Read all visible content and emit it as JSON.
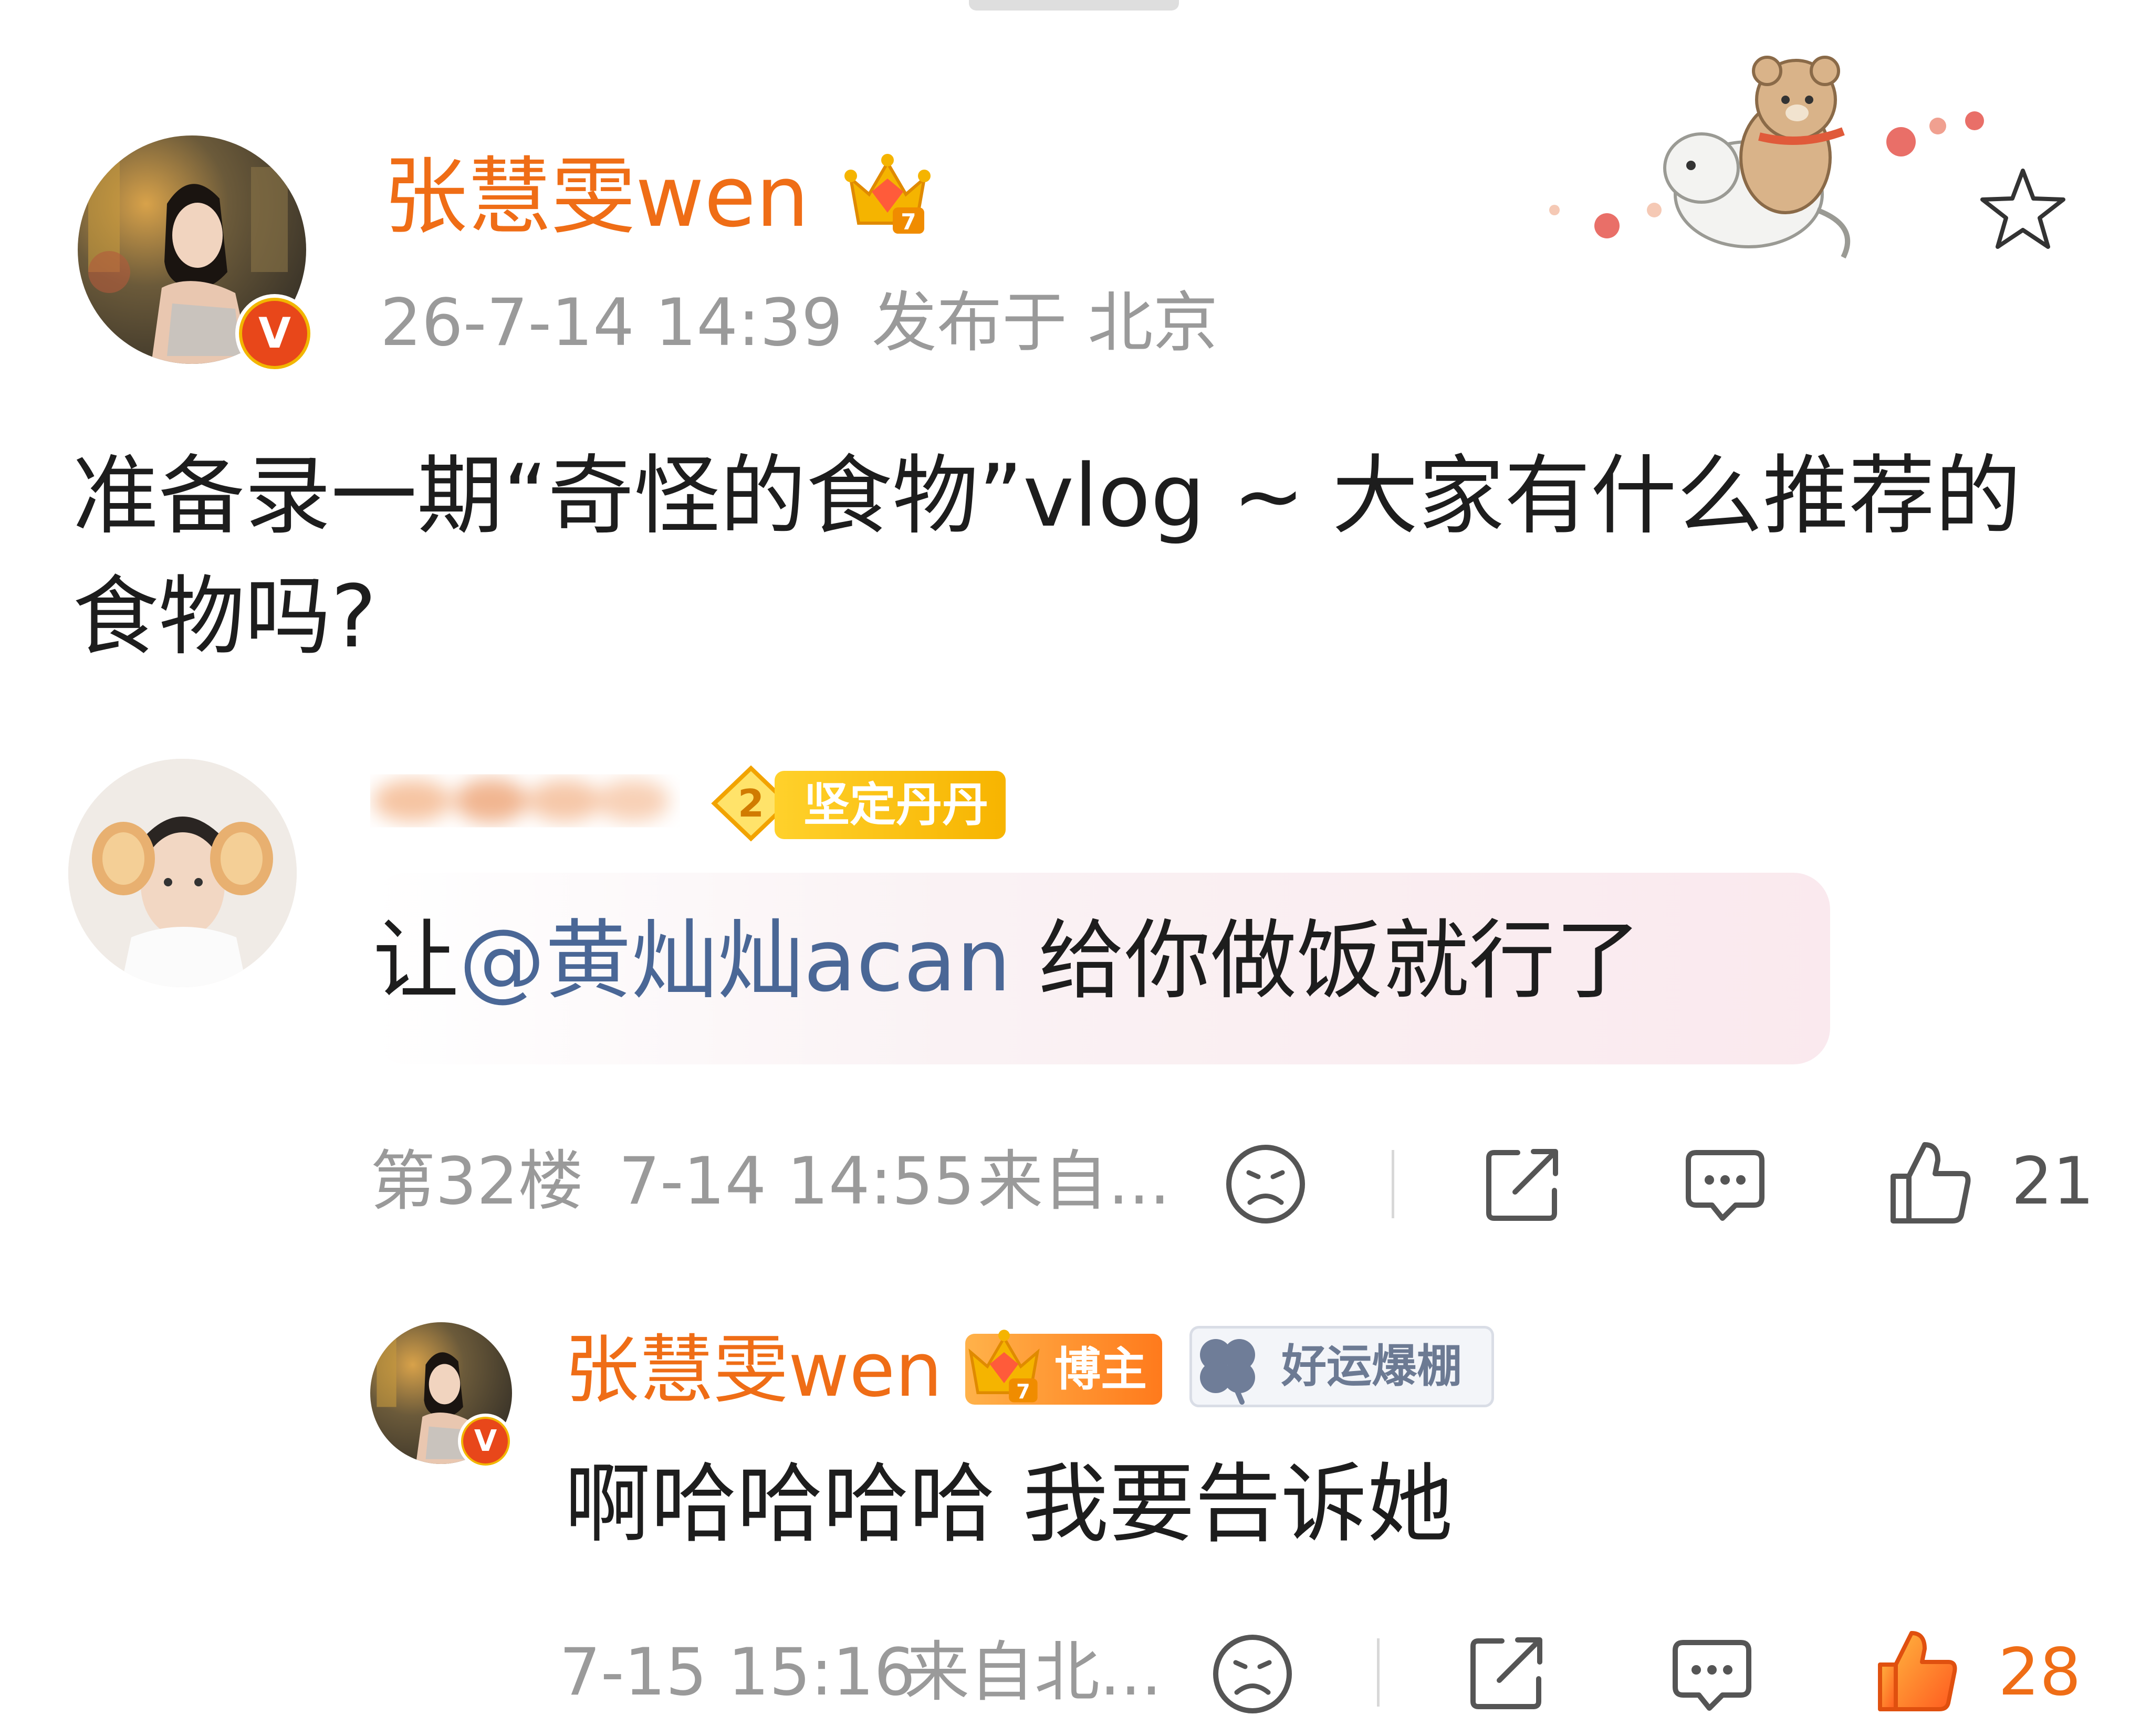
{
  "post": {
    "author_name": "张慧雯wen",
    "timestamp": "26-7-14 14:39",
    "location": "发布于 北京",
    "content_line1": "准备录一期“奇怪的食物”vlog ~ 大家有什么推荐的",
    "content_line2": "食物吗?"
  },
  "comment": {
    "badge_level": "2",
    "badge_label": "坚定丹丹",
    "text_prefix": "让",
    "mention": "@黄灿灿acan",
    "text_suffix": " 给你做饭就行了",
    "floor": "第32楼",
    "time": "7-14 14:55",
    "source": "来自...",
    "like_count": "21"
  },
  "reply": {
    "author_name": "张慧雯wen",
    "blogger_tag": "博主",
    "luck_tag": "好运爆棚",
    "text": "啊哈哈哈哈 我要告诉她",
    "time": "7-15 15:16",
    "source": "来自北...",
    "like_count": "28"
  },
  "colors": {
    "accent_orange": "#ef6d16",
    "mention_blue": "#4a6796",
    "meta_grey": "#9a9a9a",
    "text_dark": "#1d1d1d"
  }
}
